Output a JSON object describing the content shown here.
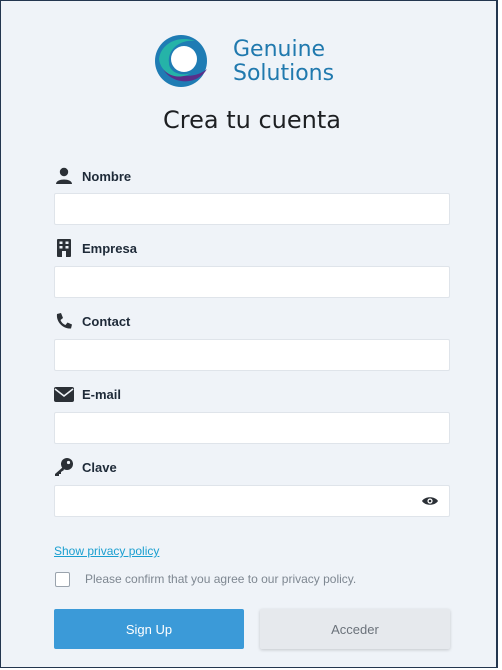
{
  "brand": {
    "line1": "Genuine",
    "line2": "Solutions"
  },
  "title": "Crea tu cuenta",
  "fields": {
    "nombre": {
      "label": "Nombre",
      "value": "",
      "icon": "user-icon"
    },
    "empresa": {
      "label": "Empresa",
      "value": "",
      "icon": "building-icon"
    },
    "contact": {
      "label": "Contact",
      "value": "",
      "icon": "phone-icon"
    },
    "email": {
      "label": "E-mail",
      "value": "",
      "icon": "envelope-icon"
    },
    "clave": {
      "label": "Clave",
      "value": "",
      "icon": "key-icon"
    }
  },
  "privacy": {
    "link": "Show privacy policy",
    "confirm": "Please confirm that you agree to our privacy policy.",
    "checked": false
  },
  "buttons": {
    "signup": "Sign Up",
    "login": "Acceder"
  },
  "colors": {
    "primary": "#3b9ad8",
    "link": "#1a9fd0",
    "brand": "#2079ae",
    "background": "#eff3f8"
  }
}
